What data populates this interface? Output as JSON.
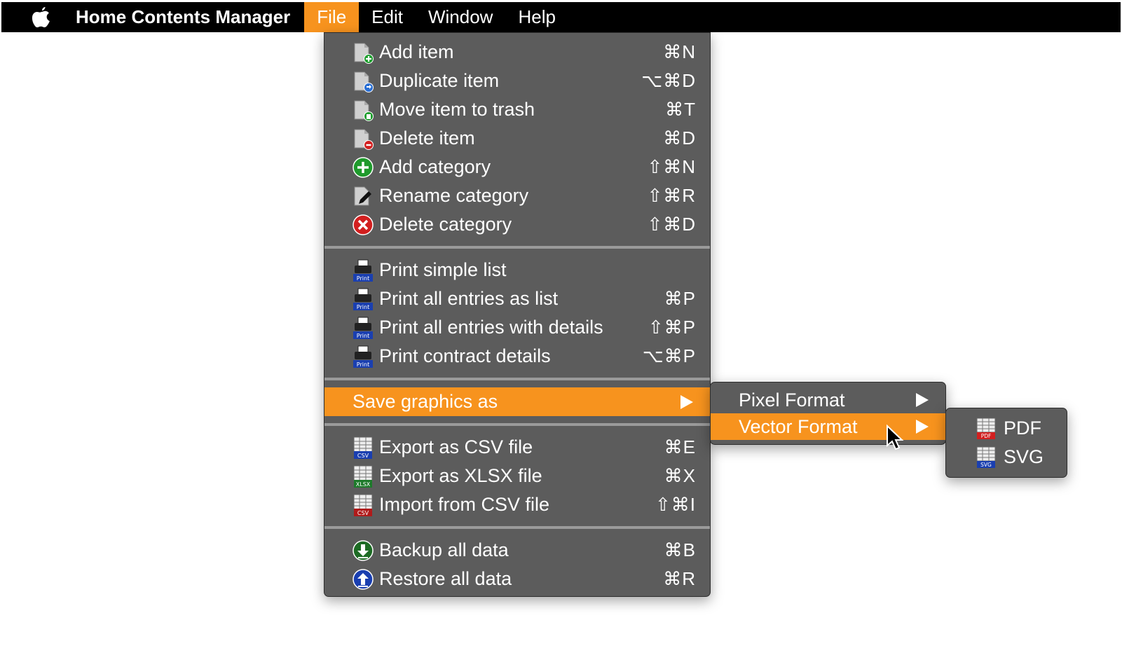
{
  "menubar": {
    "app_name": "Home Contents Manager",
    "items": [
      "File",
      "Edit",
      "Window",
      "Help"
    ]
  },
  "file_menu": {
    "group1": [
      {
        "label": "Add item",
        "shortcut": "⌘N",
        "icon": "document-add-icon"
      },
      {
        "label": "Duplicate item",
        "shortcut": "⌥⌘D",
        "icon": "document-duplicate-icon"
      },
      {
        "label": "Move item to trash",
        "shortcut": "⌘T",
        "icon": "document-trash-icon"
      },
      {
        "label": "Delete item",
        "shortcut": "⌘D",
        "icon": "document-delete-icon"
      },
      {
        "label": "Add category",
        "shortcut": "⇧⌘N",
        "icon": "green-plus-circle-icon"
      },
      {
        "label": "Rename category",
        "shortcut": "⇧⌘R",
        "icon": "pencil-document-icon"
      },
      {
        "label": "Delete category",
        "shortcut": "⇧⌘D",
        "icon": "red-x-circle-icon"
      }
    ],
    "group2": [
      {
        "label": "Print simple list",
        "shortcut": "",
        "icon": "printer-icon"
      },
      {
        "label": "Print all entries as list",
        "shortcut": "⌘P",
        "icon": "printer-icon"
      },
      {
        "label": "Print all entries with details",
        "shortcut": "⇧⌘P",
        "icon": "printer-icon"
      },
      {
        "label": "Print contract details",
        "shortcut": "⌥⌘P",
        "icon": "printer-icon"
      }
    ],
    "save_graphics": {
      "label": "Save graphics as"
    },
    "group3": [
      {
        "label": "Export as CSV file",
        "shortcut": "⌘E",
        "icon": "csv-file-icon"
      },
      {
        "label": "Export as XLSX file",
        "shortcut": "⌘X",
        "icon": "xlsx-file-icon"
      },
      {
        "label": "Import from CSV file",
        "shortcut": "⇧⌘I",
        "icon": "csv-import-icon"
      }
    ],
    "group4": [
      {
        "label": "Backup all data",
        "shortcut": "⌘B",
        "icon": "download-arrow-icon"
      },
      {
        "label": "Restore all data",
        "shortcut": "⌘R",
        "icon": "upload-arrow-icon"
      }
    ]
  },
  "format_submenu": {
    "pixel": "Pixel Format",
    "vector": "Vector Format"
  },
  "vector_submenu": {
    "pdf": "PDF",
    "svg": "SVG",
    "pdf_badge": "PDF",
    "svg_badge": "SVG"
  },
  "print_badge": "Print",
  "csv_badge": "CSV",
  "xlsx_badge": "XLSX",
  "colors": {
    "accent": "#f7931e",
    "menu_bg": "#5c5c5c",
    "menubar_bg": "#000000"
  }
}
